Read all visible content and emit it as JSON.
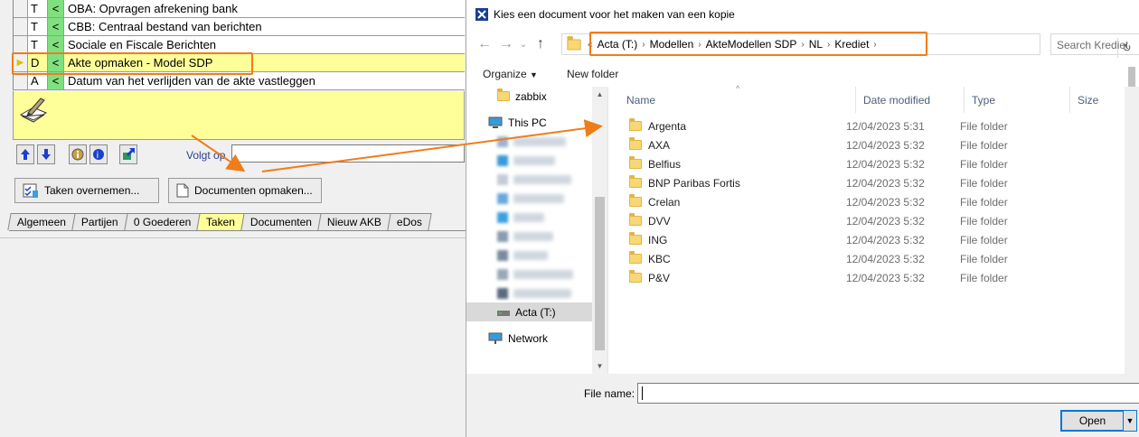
{
  "app": {
    "tasks": [
      {
        "type": "T",
        "marker": "<",
        "desc": "OBA: Opvragen afrekening bank",
        "selected": false
      },
      {
        "type": "T",
        "marker": "<",
        "desc": "CBB: Centraal bestand van berichten",
        "selected": false
      },
      {
        "type": "T",
        "marker": "<",
        "desc": "Sociale en Fiscale Berichten",
        "selected": false
      },
      {
        "type": "D",
        "marker": "<",
        "desc": "Akte opmaken - Model SDP",
        "selected": true
      },
      {
        "type": "A",
        "marker": "<",
        "desc": "Datum van het verlijden van de akte vastleggen",
        "selected": false
      }
    ],
    "volgt_op_label": "Volgt op",
    "btn_taken": "Taken overnemen...",
    "btn_documenten": "Documenten opmaken...",
    "tabs": [
      "Algemeen",
      "Partijen",
      "0 Goederen",
      "Taken",
      "Documenten",
      "Nieuw AKB",
      "eDos"
    ],
    "active_tab": "Taken"
  },
  "dialog": {
    "title": "Kies een document voor het maken van een kopie",
    "breadcrumbs": [
      "Acta (T:)",
      "Modellen",
      "AkteModellen SDP",
      "NL",
      "Krediet"
    ],
    "search_placeholder": "Search Krediet",
    "organize_label": "Organize",
    "new_folder_label": "New folder",
    "nav_items": [
      {
        "label": "zabbix",
        "kind": "folder"
      },
      {
        "label": "This PC",
        "kind": "pc"
      },
      {
        "label": "Acta (T:)",
        "kind": "drive"
      },
      {
        "label": "Network",
        "kind": "network"
      }
    ],
    "columns": {
      "name": "Name",
      "date": "Date modified",
      "type": "Type",
      "size": "Size"
    },
    "files": [
      {
        "name": "Argenta",
        "date": "12/04/2023 5:31",
        "type": "File folder"
      },
      {
        "name": "AXA",
        "date": "12/04/2023 5:32",
        "type": "File folder"
      },
      {
        "name": "Belfius",
        "date": "12/04/2023 5:32",
        "type": "File folder"
      },
      {
        "name": "BNP Paribas Fortis",
        "date": "12/04/2023 5:32",
        "type": "File folder"
      },
      {
        "name": "Crelan",
        "date": "12/04/2023 5:32",
        "type": "File folder"
      },
      {
        "name": "DVV",
        "date": "12/04/2023 5:32",
        "type": "File folder"
      },
      {
        "name": "ING",
        "date": "12/04/2023 5:32",
        "type": "File folder"
      },
      {
        "name": "KBC",
        "date": "12/04/2023 5:32",
        "type": "File folder"
      },
      {
        "name": "P&V",
        "date": "12/04/2023 5:32",
        "type": "File folder"
      }
    ],
    "file_name_label": "File name:",
    "file_name_value": "",
    "open_label": "Open"
  },
  "colors": {
    "annotation": "#f07c1a",
    "highlight_row": "#ffff99",
    "marker_green": "#7fe07f",
    "accent": "#0078d7"
  }
}
